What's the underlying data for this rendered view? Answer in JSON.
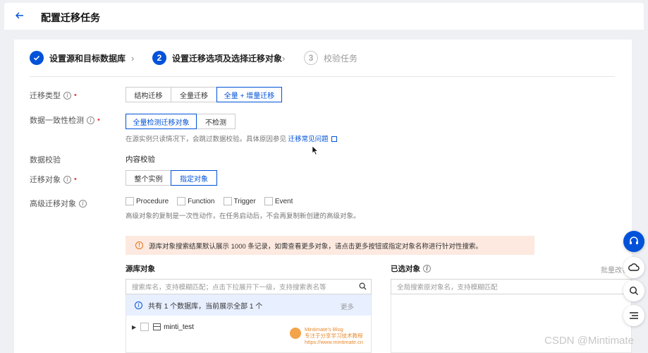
{
  "header": {
    "title": "配置迁移任务"
  },
  "steps": [
    {
      "number": "",
      "label": "设置源和目标数据库"
    },
    {
      "number": "2",
      "label": "设置迁移选项及选择迁移对象"
    },
    {
      "number": "3",
      "label": "校验任务"
    }
  ],
  "form": {
    "migration_type": {
      "label": "迁移类型",
      "options": [
        "结构迁移",
        "全量迁移",
        "全量 + 增量迁移"
      ],
      "selected": "全量 + 增量迁移"
    },
    "consistency_check": {
      "label": "数据一致性检测",
      "options": [
        "全量检测迁移对象",
        "不检测"
      ],
      "selected": "全量检测迁移对象",
      "hint": "在源实例只读情况下，会跳过数据校验。具体原因参见",
      "hint_link": "迁移常见问题"
    },
    "data_verify": {
      "label": "数据校验",
      "value": "内容校验"
    },
    "migration_object": {
      "label": "迁移对象",
      "options": [
        "整个实例",
        "指定对象"
      ],
      "selected": "指定对象"
    },
    "advanced_objects": {
      "label": "高级迁移对象",
      "options": [
        "Procedure",
        "Function",
        "Trigger",
        "Event"
      ],
      "hint": "高级对象的复制是一次性动作，在任务启动后，不会再复制新创建的高级对象。"
    }
  },
  "notice": "源库对象搜索结果默认展示 1000 条记录，如需查看更多对象，请点击更多按钮或指定对象名称进行针对性搜索。",
  "source_panel": {
    "title": "源库对象",
    "search_placeholder": "搜索库名，支持模糊匹配；点击下拉展开下一级，支持搜索表名等",
    "info": "共有 1 个数据库，当前展示全部 1 个",
    "more_label": "更多",
    "tree": [
      {
        "name": "minti_test"
      }
    ]
  },
  "dest_panel": {
    "title": "已选对象",
    "batch_label": "批量改名",
    "search_placeholder": "全局搜索原对象名，支持模糊匹配"
  },
  "watermark": {
    "blog_name": "Mintimate's Blog",
    "blog_sub": "专注于分享学习技术教程",
    "blog_url": "https://www.mintimate.cn",
    "csdn": "CSDN @Mintimate"
  },
  "colors": {
    "accent": "#0052d9",
    "notice_bg": "#fde9e0",
    "required": "#e54545"
  },
  "icons": [
    "back-arrow-icon",
    "check-icon",
    "chevron-right-icon",
    "info-icon",
    "external-link-icon",
    "warning-icon",
    "search-icon",
    "database-icon",
    "headset-icon",
    "cloud-icon",
    "list-icon"
  ]
}
